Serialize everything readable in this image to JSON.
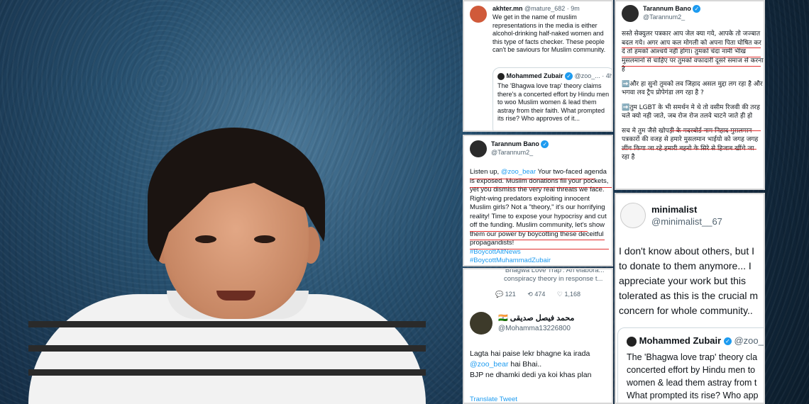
{
  "card1": {
    "name": "akhter.mn",
    "handle": "@mature_682",
    "time": "· 9m",
    "text": "We get in the name of muslim representations in the media is either alcohol-drinking half-naked women and this type of facts checker. These people can't be saviours for Muslim community.",
    "quote": {
      "name": "Mohammed Zubair",
      "handle": "@zoo_...",
      "time": "· 4h",
      "text": "The 'Bhagwa love trap' theory claims there's a concerted effort by Hindu men to woo Muslim women & lead them astray from their faith. What prompted its rise? Who approves of it..."
    }
  },
  "card2": {
    "name": "Tarannum Bano",
    "handle": "@Tarannum2_",
    "para1": "सस्ते सेक्युलर पत्रकार आप जेल क्या गये, आपके तो जज्बात बदल गये। अगर आप कल मोगली को अपना पिता घोषित कर दे तो हमको आश्चर्य नही होगा। तुमको चंदा नामी भीख मुसलमानो से चाहिए पर तुमको वफादारी दूसरे समाज से करना है",
    "para2": "➡️और हा सुनो तुमको लव जिहाद असल मुद्दा लग रहा है और भगवा लव ट्रैप प्रोपेगंडा लग रहा है ?",
    "para3": "➡️तुम LGBT के भी समर्थन मे थे तो वसीम रिजवी की तरह चले क्यो नही जाते, जब रोज रोज तलवे चाटने जाते ही हो",
    "para4": "सच मे तुम जैसे खोपड़ी के मदरबोर्ड नाम निहाद मुसलमान पत्रकारों की वजह से हमारे मुसलमान भाईयो को जगह जगह लींच किया जा रहे हमारी बहनो के सिरे से हिजाब खींचे जा रहा है"
  },
  "card3": {
    "name": "Tarannum Bano",
    "handle": "@Tarannum2_",
    "line1": "Listen up, ",
    "mention": "@zoo_bear",
    "line1b": " Your two-faced agenda is exposed. Muslim donations fill your pockets, yet you dismiss the very real threats we face. Right-wing predators exploiting innocent Muslim girls? Not a \"theory,\" it's our horrifying reality! Time to expose your hypocrisy and cut off the funding. Muslim community, let's show them our power by boycotting these deceitful propagandists!",
    "tag1": "#BoycottAltNews",
    "tag2": "#BoycottMuhammadZubair"
  },
  "card4": {
    "quote_text": "'Bhagwa Love Trap': An elabora... conspiracy theory in response t...",
    "replies": "121",
    "retweets": "474",
    "likes": "1,168",
    "name": "محمد فيصل صديقى",
    "flag": "🇮🇳",
    "handle": "@Mohamma13226800",
    "text1": "Lagta hai paise lekr bhagne ka irada",
    "mention": "@zoo_bear",
    "text2": " hai Bhai..",
    "text3": "BJP ne dhamki dedi ya koi khas plan",
    "translate": "Translate Tweet"
  },
  "card5": {
    "name": "minimalist",
    "handle": "@minimalist__67",
    "text": "I don't know about others, but I to donate to them anymore... I appreciate your work but this tolerated as this is the crucial m concern for whole community..",
    "quote": {
      "name": "Mohammed Zubair",
      "handle": "@zoo_...",
      "text": "The 'Bhagwa love trap' theory cla concerted effort by Hindu men to women & lead them astray from t What prompted its rise? Who app"
    }
  },
  "colors": {
    "accent": "#1d9bf0",
    "underline": "#e2302f"
  }
}
